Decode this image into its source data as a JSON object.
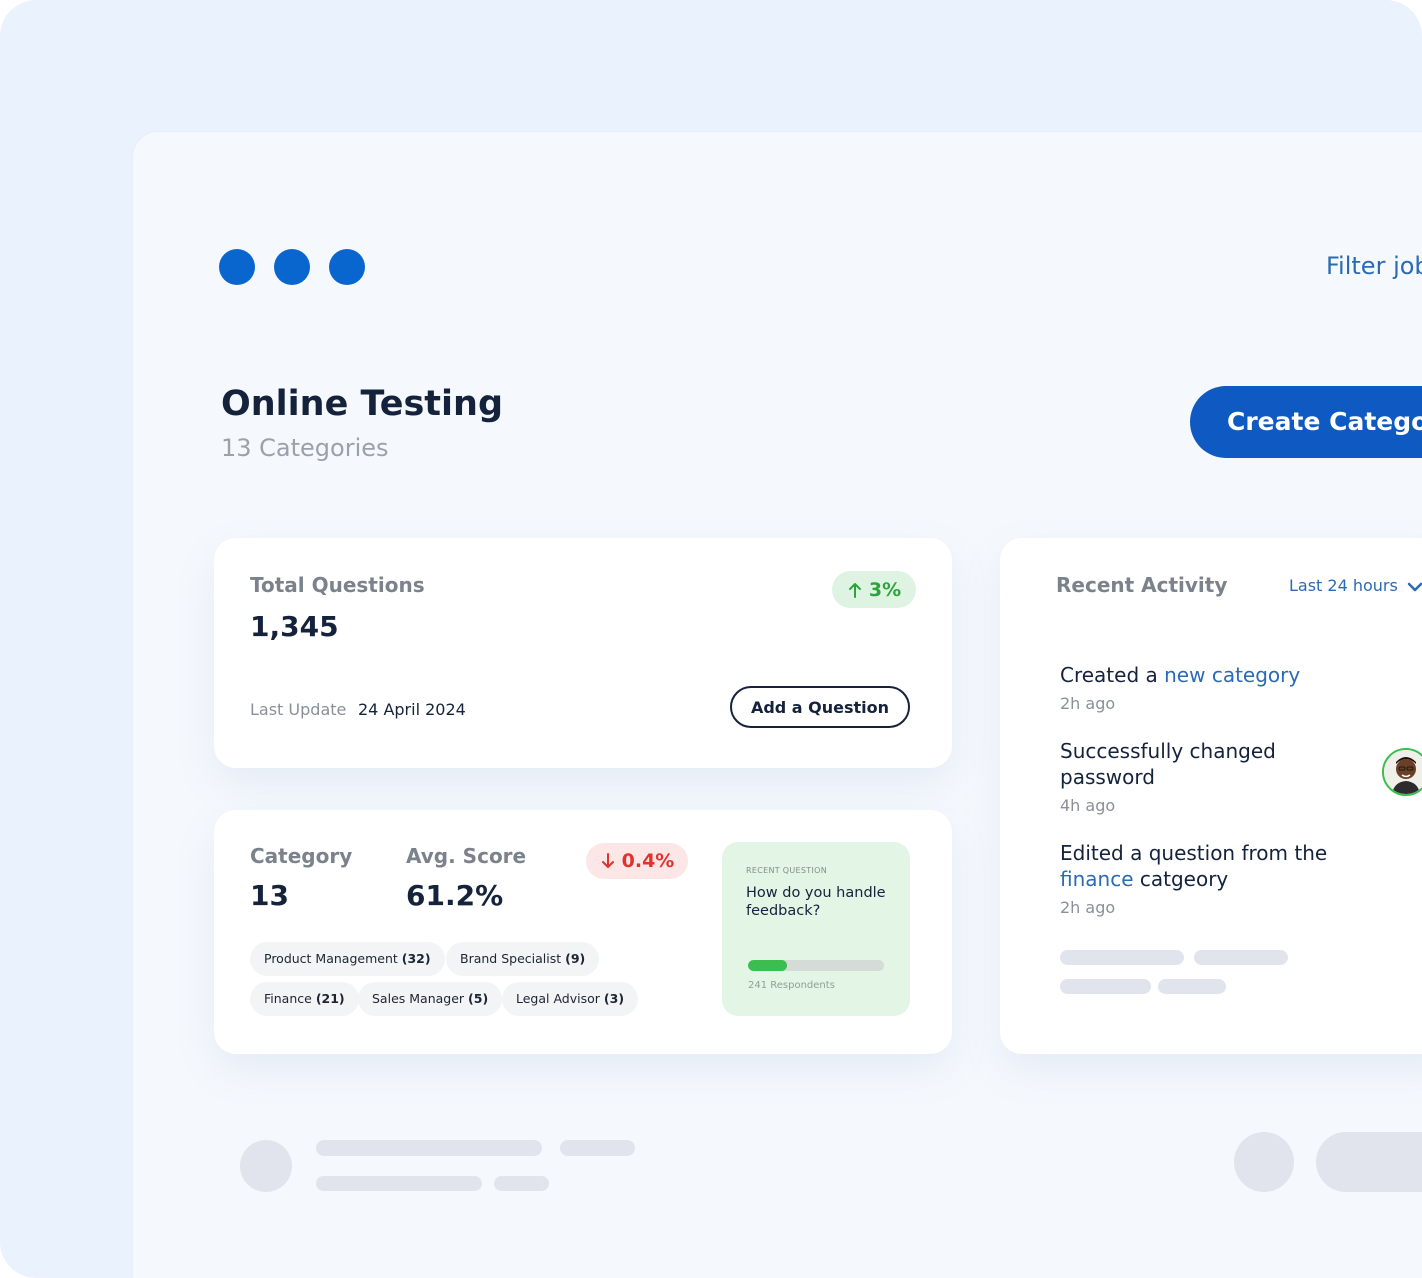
{
  "header": {
    "filter_label": "Filter jobs",
    "title": "Online Testing",
    "subtitle": "13 Categories",
    "create_button": "Create Category"
  },
  "total_questions": {
    "label": "Total Questions",
    "value": "1,345",
    "change": "3%",
    "change_color": "#2aa43b",
    "last_update_label": "Last Update",
    "last_update_date": "24 April 2024",
    "add_button": "Add a Question"
  },
  "category_card": {
    "category_label": "Category",
    "category_value": "13",
    "score_label": "Avg. Score",
    "score_value": "61.2%",
    "score_change": "0.4%",
    "score_change_color": "#e0332f",
    "tags": [
      {
        "name": "Product Management",
        "count": "(32)"
      },
      {
        "name": "Brand Specialist",
        "count": "(9)"
      },
      {
        "name": "Finance",
        "count": "(21)"
      },
      {
        "name": "Sales Manager",
        "count": "(5)"
      },
      {
        "name": "Legal Advisor",
        "count": "(3)"
      }
    ],
    "recent_question": {
      "heading": "RECENT QUESTION",
      "text": "How do you handle feedback?",
      "progress": 0.29,
      "respondents": "241 Respondents"
    }
  },
  "activity": {
    "title": "Recent Activity",
    "range": "Last 24 hours",
    "items": [
      {
        "prefix": "Created a ",
        "highlight": "new category",
        "suffix": "",
        "time": "2h ago"
      },
      {
        "prefix": "Successfully changed password",
        "highlight": "",
        "suffix": "",
        "time": "4h ago"
      },
      {
        "prefix": "Edited a question from the ",
        "highlight": "finance",
        "suffix": " catgeory",
        "time": "2h ago"
      }
    ]
  },
  "icons": {
    "up": "arrow-up-icon",
    "down": "arrow-down-icon",
    "chevron": "chevron-down-icon"
  }
}
